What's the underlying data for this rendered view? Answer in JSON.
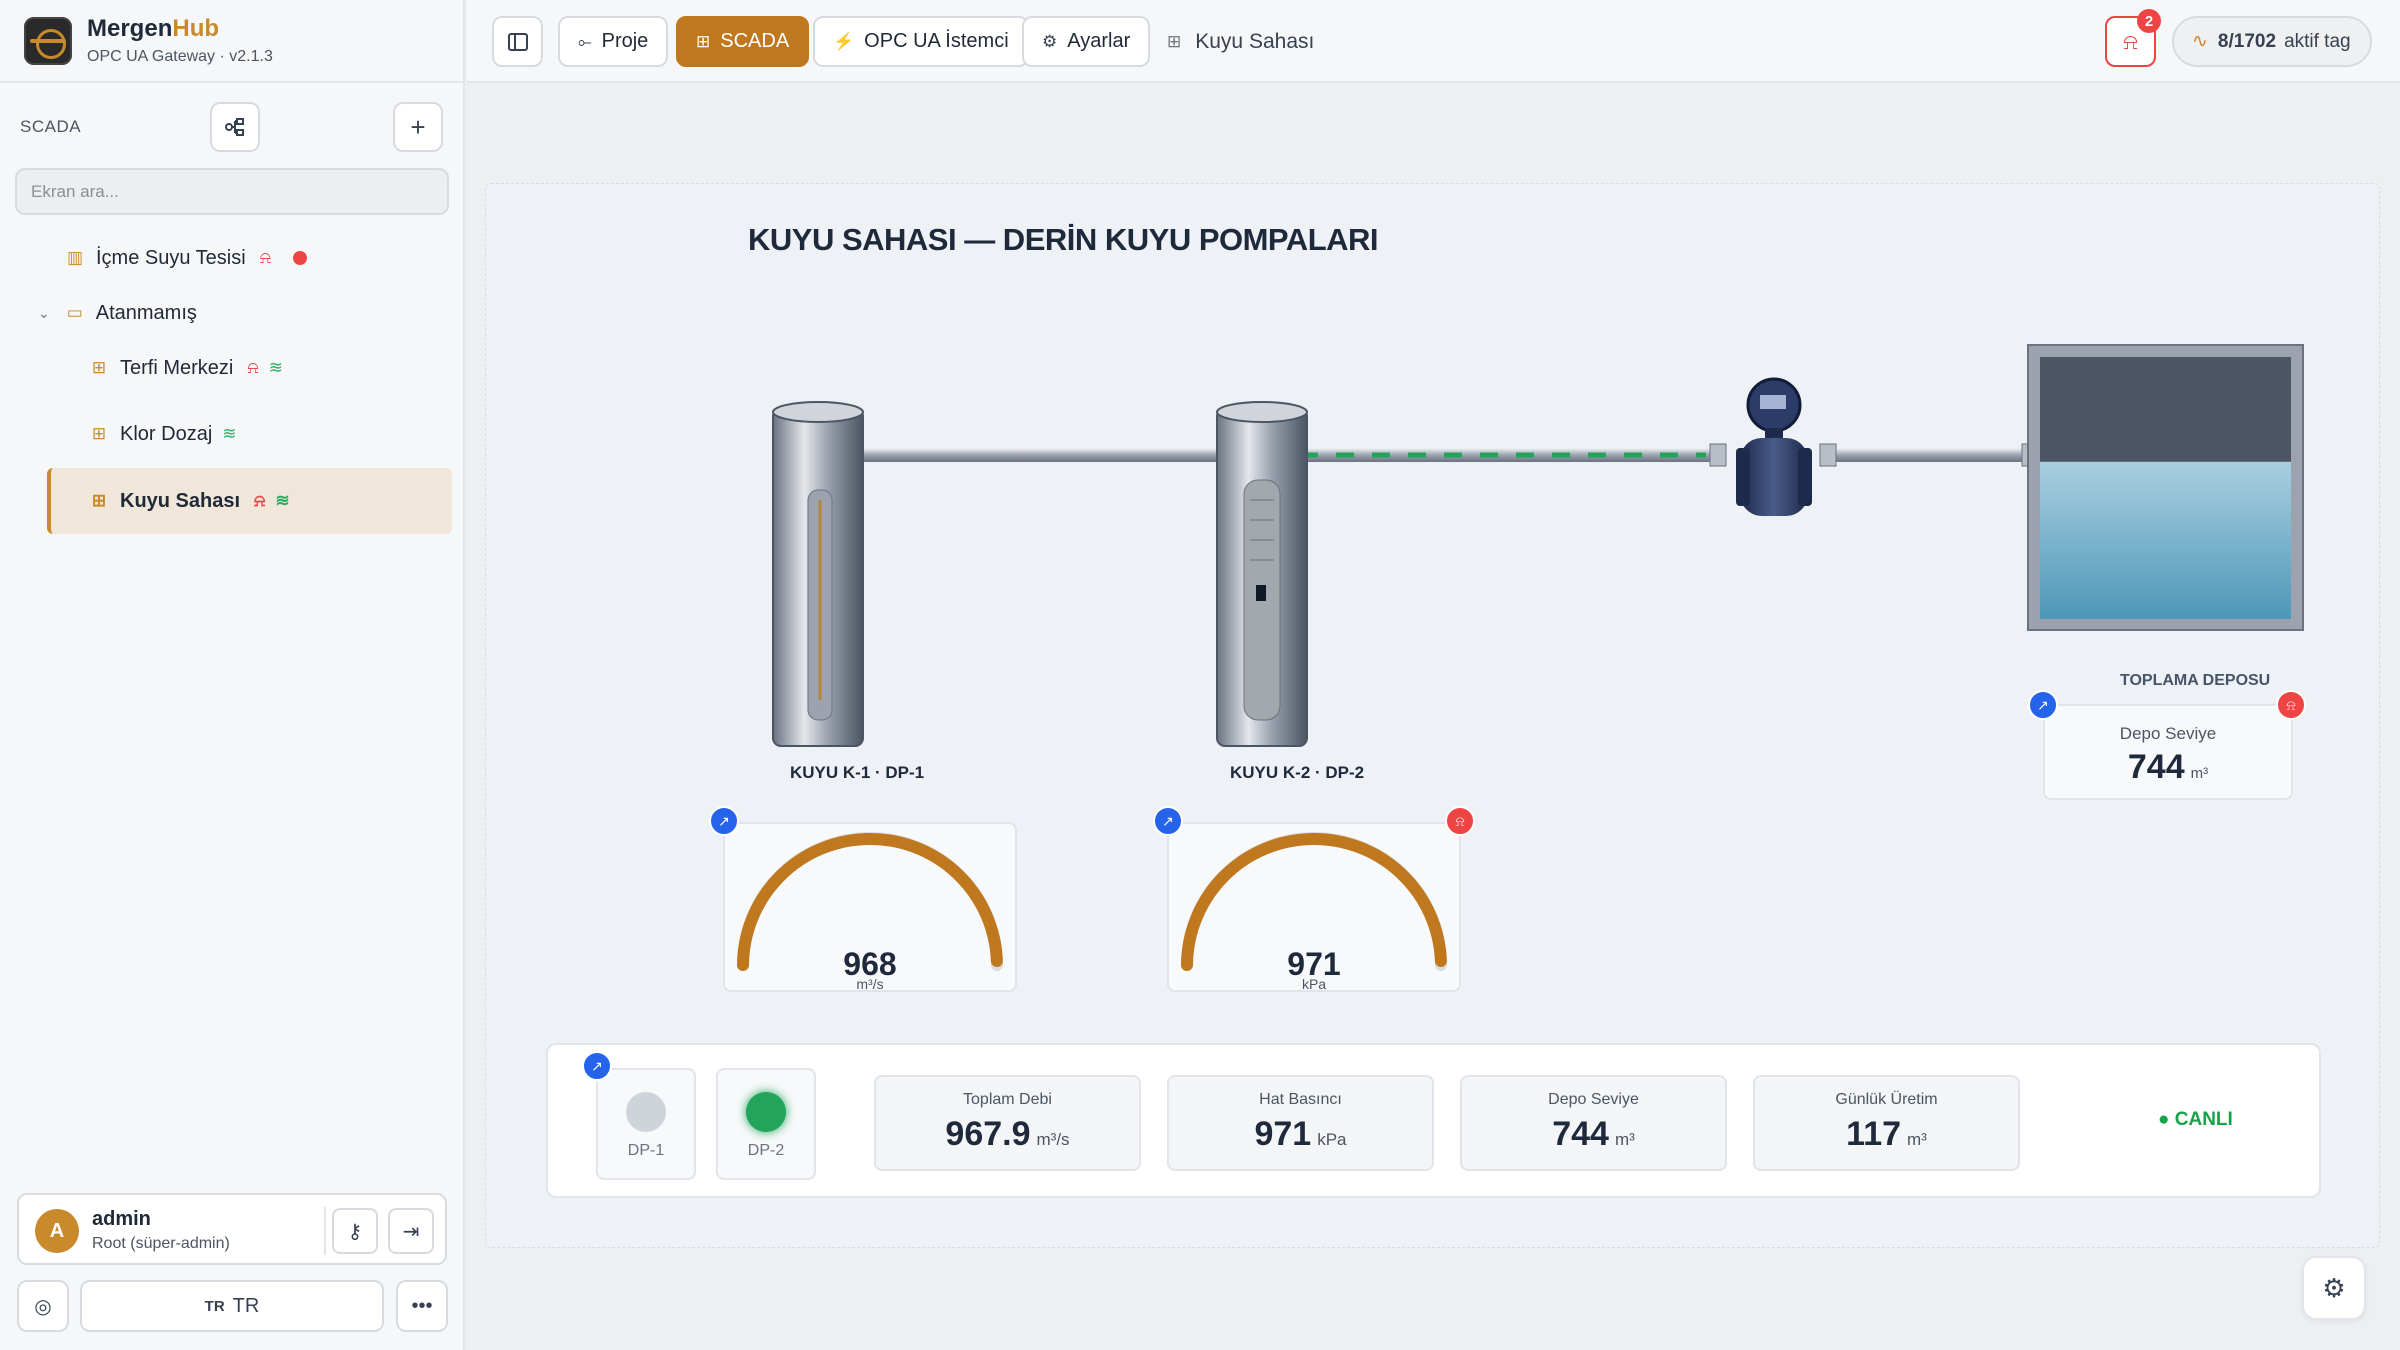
{
  "brand": {
    "name_a": "Mergen",
    "name_b": "Hub",
    "subtitle": "OPC UA Gateway · v2.1.3"
  },
  "sidebar": {
    "section": "SCADA",
    "search_placeholder": "Ekran ara...",
    "tree": [
      {
        "label": "İçme Suyu Tesisi",
        "icon": "factory-icon",
        "alarm": true,
        "status": "red-dot"
      },
      {
        "label": "Atanmamış",
        "icon": "folder-icon",
        "expanded": true
      },
      {
        "label": "Terfi Merkezi",
        "icon": "grid-icon",
        "alarm": true,
        "wifi": true
      },
      {
        "label": "Klor Dozaj",
        "icon": "grid-icon",
        "wifi": true
      },
      {
        "label": "Kuyu Sahası",
        "icon": "grid-icon",
        "alarm": true,
        "wifi": true,
        "active": true
      }
    ],
    "user": {
      "initial": "A",
      "name": "admin",
      "role": "Root (süper-admin)"
    },
    "language": {
      "code": "TR",
      "label": "TR"
    }
  },
  "topbar": {
    "tabs": [
      {
        "label": "Proje",
        "icon": "project-icon"
      },
      {
        "label": "SCADA",
        "icon": "grid-icon",
        "active": true
      },
      {
        "label": "OPC UA İstemci",
        "icon": "plug-icon"
      },
      {
        "label": "Ayarlar",
        "icon": "gear-icon"
      }
    ],
    "breadcrumb": "Kuyu Sahası",
    "notifications": "2",
    "tags": {
      "active": "8",
      "total": "1702",
      "label": "aktif tag"
    }
  },
  "scada": {
    "title": "KUYU SAHASI — DERİN KUYU POMPALARI",
    "wells": [
      {
        "label": "KUYU K-1 · DP-1",
        "gauge_value": "968",
        "gauge_unit": "m³/s",
        "gauge_fraction": 0.99,
        "alarm": false
      },
      {
        "label": "KUYU K-2 · DP-2",
        "gauge_value": "971",
        "gauge_unit": "kPa",
        "gauge_fraction": 0.99,
        "alarm": true
      }
    ],
    "tank": {
      "title": "TOPLAMA DEPOSU",
      "label": "Depo Seviye",
      "value": "744",
      "unit": "m³",
      "level_fraction": 0.6
    },
    "pumps": [
      {
        "label": "DP-1",
        "running": false
      },
      {
        "label": "DP-2",
        "running": true
      }
    ],
    "stats": [
      {
        "label": "Toplam Debi",
        "value": "967.9",
        "unit": "m³/s"
      },
      {
        "label": "Hat Basıncı",
        "value": "971",
        "unit": "kPa"
      },
      {
        "label": "Depo Seviye",
        "value": "744",
        "unit": "m³"
      },
      {
        "label": "Günlük Üretim",
        "value": "117",
        "unit": "m³"
      }
    ],
    "live": "● CANLI"
  },
  "colors": {
    "accent": "#c0781f",
    "alarm": "#ef4444",
    "ok": "#22a55a",
    "trend": "#2563eb"
  }
}
